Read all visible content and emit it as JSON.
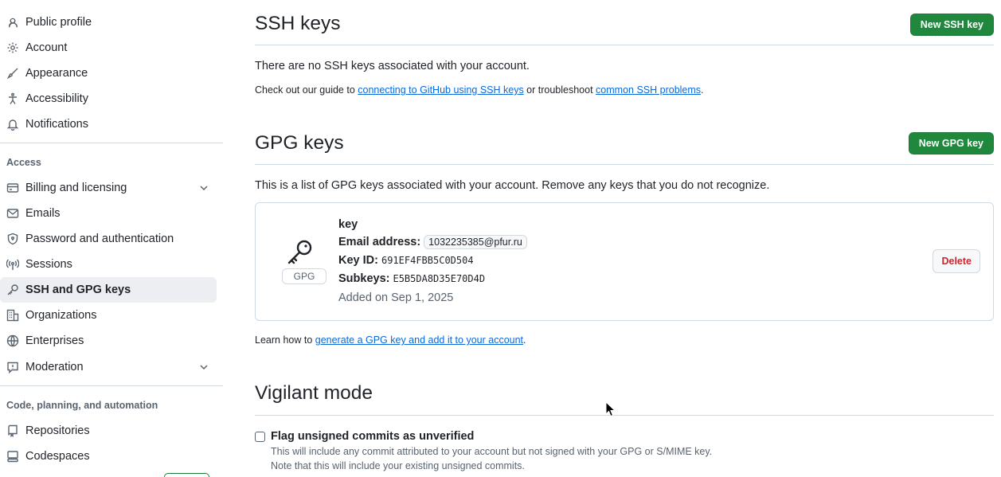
{
  "sidebar": {
    "items_top": [
      {
        "label": "Public profile",
        "icon": "person-icon"
      },
      {
        "label": "Account",
        "icon": "gear-icon"
      },
      {
        "label": "Appearance",
        "icon": "paintbrush-icon"
      },
      {
        "label": "Accessibility",
        "icon": "accessibility-icon"
      },
      {
        "label": "Notifications",
        "icon": "bell-icon"
      }
    ],
    "access_title": "Access",
    "access_items": [
      {
        "label": "Billing and licensing",
        "icon": "credit-card-icon"
      },
      {
        "label": "Emails",
        "icon": "mail-icon"
      },
      {
        "label": "Password and authentication",
        "icon": "shield-lock-icon"
      },
      {
        "label": "Sessions",
        "icon": "broadcast-icon"
      },
      {
        "label": "SSH and GPG keys",
        "icon": "key-icon"
      },
      {
        "label": "Organizations",
        "icon": "organization-icon"
      },
      {
        "label": "Enterprises",
        "icon": "globe-icon"
      },
      {
        "label": "Moderation",
        "icon": "report-icon"
      }
    ],
    "code_title": "Code, planning, and automation",
    "code_items": [
      {
        "label": "Repositories",
        "icon": "repo-icon"
      },
      {
        "label": "Codespaces",
        "icon": "codespaces-icon"
      }
    ]
  },
  "ssh": {
    "title": "SSH keys",
    "new_button": "New SSH key",
    "empty_text": "There are no SSH keys associated with your account.",
    "guide_prefix": "Check out our guide to ",
    "guide_link": "connecting to GitHub using SSH keys",
    "guide_middle": " or troubleshoot ",
    "guide_link2": "common SSH problems",
    "guide_suffix": "."
  },
  "gpg": {
    "title": "GPG keys",
    "new_button": "New GPG key",
    "description": "This is a list of GPG keys associated with your account. Remove any keys that you do not recognize.",
    "key": {
      "badge": "GPG",
      "name": "key",
      "email_label": "Email address:",
      "email": "1032235385@pfur.ru",
      "key_id_label": "Key ID:",
      "key_id": "691EF4FBB5C0D504",
      "subkeys_label": "Subkeys:",
      "subkeys": "E5B5DA8D35E70D4D",
      "added": "Added on Sep 1, 2025",
      "delete_button": "Delete"
    },
    "learn_prefix": "Learn how to ",
    "learn_link": "generate a GPG key and add it to your account",
    "learn_suffix": "."
  },
  "vigilant": {
    "title": "Vigilant mode",
    "checkbox_label": "Flag unsigned commits as unverified",
    "checkbox_checked": false,
    "desc1": "This will include any commit attributed to your account but not signed with your GPG or S/MIME key.",
    "desc2": "Note that this will include your existing unsigned commits."
  },
  "colors": {
    "accent": "#0969da",
    "primary_button": "#1f883d",
    "danger": "#d1242f",
    "border": "#d1d9e0",
    "muted": "#59636e"
  }
}
